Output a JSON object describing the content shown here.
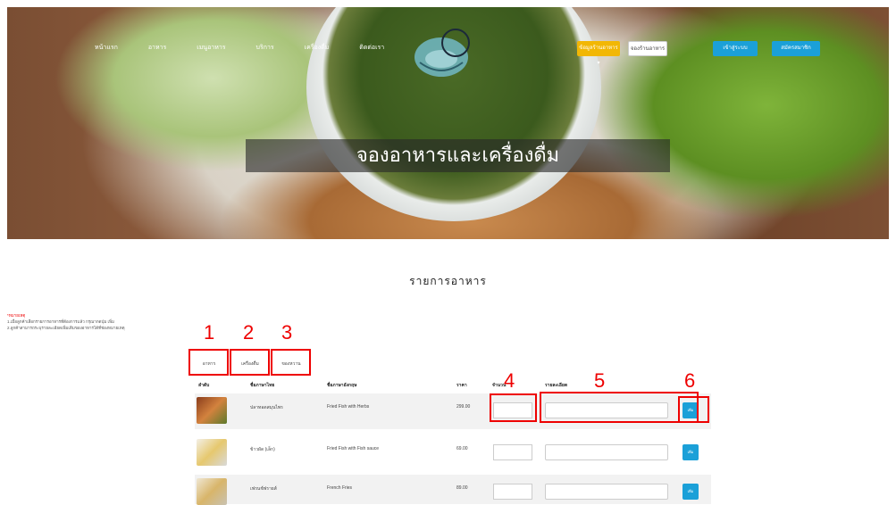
{
  "nav": {
    "items": [
      "หน้าแรก",
      "อาหาร",
      "เมนูอาหาร",
      "บริการ",
      "เครื่องดื่ม",
      "ติดต่อเรา"
    ],
    "dropdown_label": "ข้อมูลร้านอาหาร ▾",
    "outline_label": "จองร้านอาหาร",
    "login_label": "เข้าสู่ระบบ",
    "register_label": "สมัครสมาชิก"
  },
  "hero": {
    "title": "จองอาหารและเครื่องดื่ม"
  },
  "section": {
    "title": "รายการอาหาร"
  },
  "note": {
    "heading": "*หมายเหตุ",
    "line1": "1.เมื่อลูกค้าเลือกรายการอาหารที่ต้องการแล้ว กรุณากดปุ่ม เพิ่ม",
    "line2": "2.ลูกค้าสามารถระบุรายละเอียดเพิ่มเติมของอาหารได้ที่ช่องหมายเหตุ"
  },
  "tabs": [
    "อาหาร",
    "เครื่องดื่ม",
    "ของหวาน"
  ],
  "table": {
    "headers": [
      "ลำดับ",
      "ชื่อภาษาไทย",
      "ชื่อภาษาอังกฤษ",
      "ราคา",
      "จำนวน",
      "รายละเอียด"
    ],
    "rows": [
      {
        "th": "ปลาทอดสมุนไพร",
        "en": "Fried Fish with Herbs",
        "price": "299.00",
        "button": "เพิ่ม"
      },
      {
        "th": "ข้าวผัด (เล็ก)",
        "en": "Fried Fish with Fish sauce",
        "price": "69.00",
        "button": "เพิ่ม"
      },
      {
        "th": "เฟรนช์ฟรายส์",
        "en": "French Fries",
        "price": "89.00",
        "button": "เพิ่ม"
      }
    ]
  },
  "annotations": [
    "1",
    "2",
    "3",
    "4",
    "5",
    "6"
  ],
  "colors": {
    "accent": "#1ba0d8",
    "dropdown": "#f2b705",
    "annotation": "#e00000"
  }
}
